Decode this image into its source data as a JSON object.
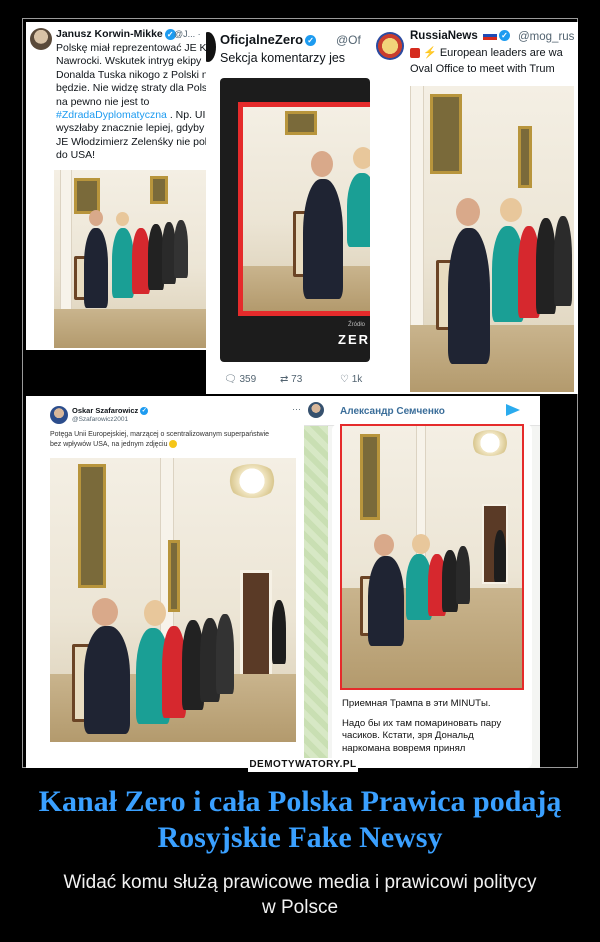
{
  "panel1": {
    "username": "Janusz Korwin-Mikke",
    "handle": "@J... ·",
    "lines": [
      "Polskę miał reprezentować JE Ka",
      "Nawrocki. Wskutek intryg ekipy",
      "Donalda Tuska nikogo z Polski n",
      "będzie. Nie widzę straty dla Pols",
      "na pewno nie jest to"
    ],
    "hashtag": "#ZdradaDyplomatyczna",
    "lines2": [
      ". Np. UI",
      "wyszłaby znacznie lepiej, gdyby",
      "JE Włodzimierz Zelenśky nie pol",
      "do USA!"
    ]
  },
  "panel2": {
    "username": "OficjalneZero",
    "handle": "@Of",
    "text": "Sekcja komentarzy jes",
    "video_label": "ZER",
    "source": "Źródło",
    "replies": "359",
    "retweets": "73",
    "likes": "1k"
  },
  "panel3": {
    "username": "RussiaNews",
    "handle": "@mog_rus",
    "line1": "European leaders are wa",
    "line2": "Oval Office to meet with Trum"
  },
  "panel4": {
    "username": "Oskar Szafarowicz",
    "handle": "@Szafarowicz2001",
    "line1": "Potęga Unii Europejskiej, marzącej o scentralizowanym superpaństwie",
    "line2": "bez wpływów USA, na jednym zdjęciu"
  },
  "panel5": {
    "channel": "Александр Семченко",
    "line1": "Приемная Трампа в эти MINUTы.",
    "line2": "Надо бы их там помариновать пару",
    "line3": "часиков. Кстати, зря Дональд",
    "line4": "наркомана вовремя принял"
  },
  "watermark": "DEMOTYWATORY.PL",
  "title_line1": "Kanał Zero i cała Polska Prawica podają",
  "title_line2": "Rosyjskie Fake Newsy",
  "subtitle_line1": "Widać komu służą prawicowe media i prawicowi politycy",
  "subtitle_line2": "w Polsce",
  "colors": {
    "title": "#3aa0ff",
    "verified": "#1d9bf0",
    "telegram": "#3a6d99",
    "frame_red": "#e52b2b"
  }
}
